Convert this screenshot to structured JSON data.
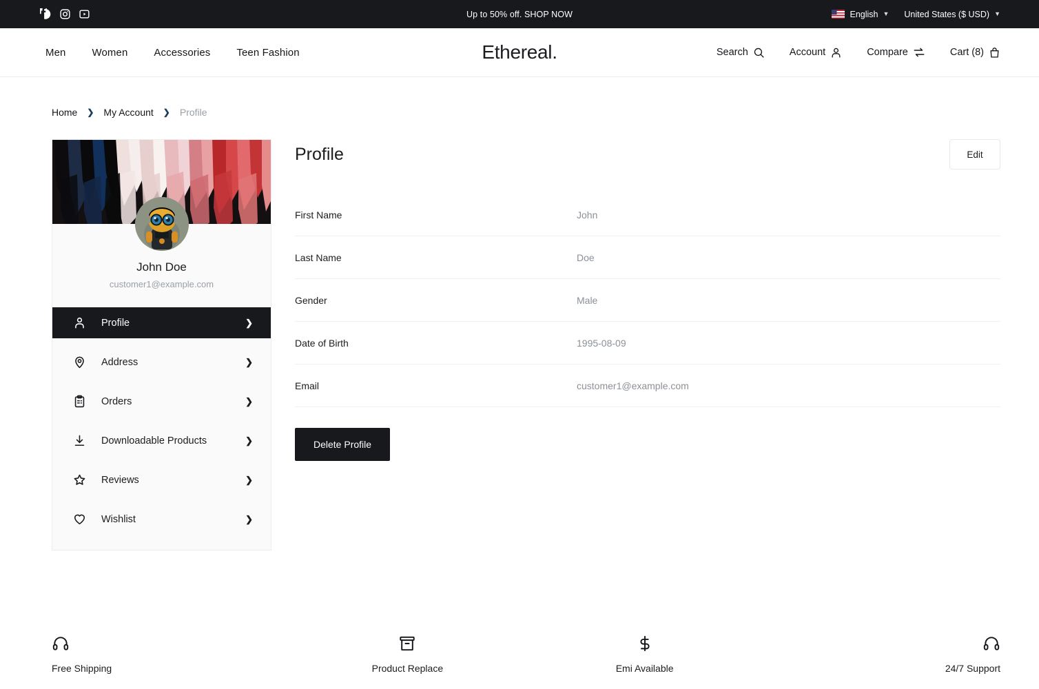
{
  "announcement": {
    "message": "Up to 50% off. SHOP NOW",
    "social": [
      {
        "name": "facebook-icon",
        "label": "Facebook"
      },
      {
        "name": "instagram-icon",
        "label": "Instagram"
      },
      {
        "name": "youtube-icon",
        "label": "YouTube"
      }
    ],
    "language": "English",
    "language_flag": "united-states-flag",
    "currency": "United States ($ USD)"
  },
  "header": {
    "logo": "Ethereal.",
    "nav": [
      {
        "label": "Men"
      },
      {
        "label": "Women"
      },
      {
        "label": "Accessories"
      },
      {
        "label": "Teen Fashion"
      }
    ],
    "actions": [
      {
        "label": "Search",
        "icon": "search-icon"
      },
      {
        "label": "Account",
        "icon": "user-icon"
      },
      {
        "label": "Compare",
        "icon": "compare-arrows-icon"
      },
      {
        "label": "Cart (8)",
        "icon": "shopping-bag-icon"
      }
    ],
    "cart_count": 8
  },
  "breadcrumb": {
    "items": [
      {
        "label": "Home",
        "current": false
      },
      {
        "label": "My Account",
        "current": false
      },
      {
        "label": "Profile",
        "current": true
      }
    ],
    "separator": "›"
  },
  "sidebar": {
    "banner_alt": "hanging pink and red fabric strips",
    "avatar_alt": "robot avatar",
    "user_name": "John Doe",
    "user_email": "customer1@example.com",
    "items": [
      {
        "label": "Profile",
        "icon": "user-icon",
        "active": true
      },
      {
        "label": "Address",
        "icon": "map-pin-icon",
        "active": false
      },
      {
        "label": "Orders",
        "icon": "clipboard-icon",
        "active": false
      },
      {
        "label": "Downloadable Products",
        "icon": "download-icon",
        "active": false
      },
      {
        "label": "Reviews",
        "icon": "star-icon",
        "active": false
      },
      {
        "label": "Wishlist",
        "icon": "heart-icon",
        "active": false
      }
    ],
    "chevron": "›"
  },
  "main": {
    "title": "Profile",
    "edit_label": "Edit",
    "fields": [
      {
        "label": "First Name",
        "value": "John"
      },
      {
        "label": "Last Name",
        "value": "Doe"
      },
      {
        "label": "Gender",
        "value": "Male"
      },
      {
        "label": "Date of Birth",
        "value": "1995-08-09"
      },
      {
        "label": "Email",
        "value": "customer1@example.com"
      }
    ],
    "delete_label": "Delete Profile"
  },
  "features": [
    {
      "label": "Free Shipping",
      "icon": "headphones-icon"
    },
    {
      "label": "Product Replace",
      "icon": "box-icon"
    },
    {
      "label": "Emi Available",
      "icon": "dollar-icon"
    },
    {
      "label": "24/7 Support",
      "icon": "headphones-icon"
    }
  ],
  "colors": {
    "dark": "#17191c",
    "muted": "#8b9197",
    "card_bg": "#fafafa",
    "border": "#ededed"
  }
}
